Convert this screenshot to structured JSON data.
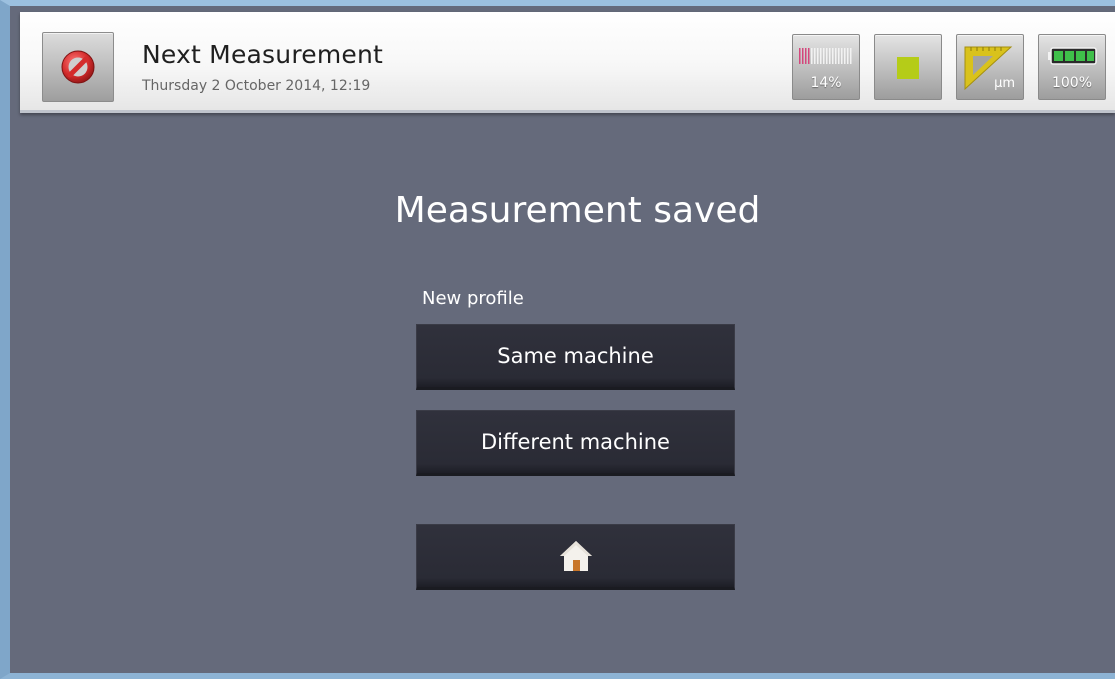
{
  "header": {
    "title": "Next Measurement",
    "subtitle": "Thursday 2 October 2014, 12:19",
    "cancel_icon": "prohibited-icon"
  },
  "status": {
    "signal": {
      "icon": "signal-bars-icon",
      "label": "14%",
      "level": 0.14
    },
    "record": {
      "icon": "square-stop-icon",
      "color": "#b5cc18"
    },
    "units": {
      "icon": "set-square-icon",
      "label": "µm"
    },
    "battery": {
      "icon": "battery-icon",
      "label": "100%",
      "level": 1.0
    }
  },
  "main": {
    "title": "Measurement saved",
    "section_label": "New profile",
    "same_machine_label": "Same machine",
    "different_machine_label": "Different machine",
    "home_icon": "home-icon"
  },
  "colors": {
    "background": "#656a7b",
    "button": "#2b2c36",
    "accent_green": "#b5cc18",
    "signal_pink": "#d4477c",
    "ruler_yellow": "#d9c21c",
    "cancel_red": "#cc2a2a",
    "home_orange": "#c8762a"
  }
}
